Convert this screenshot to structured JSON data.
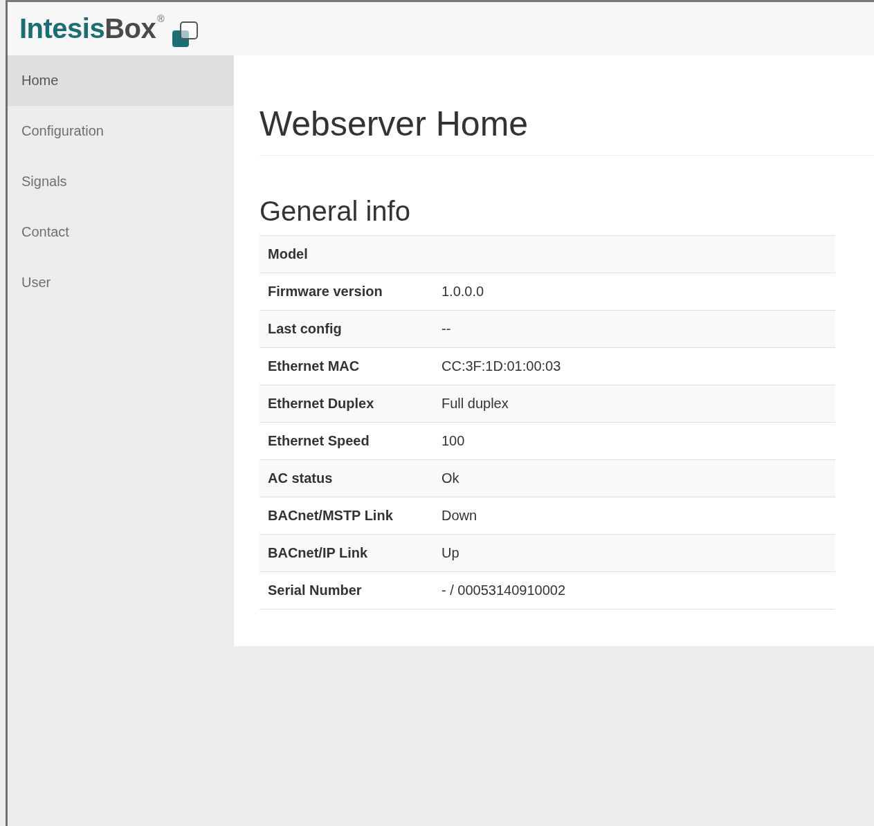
{
  "logo": {
    "parts": [
      "Intesis",
      "Box"
    ],
    "mark": "®"
  },
  "sidebar": {
    "items": [
      {
        "label": "Home",
        "selected": true
      },
      {
        "label": "Configuration",
        "selected": false
      },
      {
        "label": "Signals",
        "selected": false
      },
      {
        "label": "Contact",
        "selected": false
      },
      {
        "label": "User",
        "selected": false
      }
    ]
  },
  "page_title": "Webserver Home",
  "section_title": "General info",
  "table": {
    "rows": [
      {
        "label": "Model"
      },
      {
        "label": "Firmware version",
        "value": "1.0.0.0"
      },
      {
        "label": "Last config",
        "value": "--"
      },
      {
        "label": "Ethernet MAC",
        "value": "CC:3F:1D:01:00:03"
      },
      {
        "label": "Ethernet Duplex",
        "value": "Full duplex"
      },
      {
        "label": "Ethernet Speed",
        "value": "100"
      },
      {
        "label": "AC status",
        "value": "Ok"
      },
      {
        "label": "BACnet/MSTP Link",
        "value": "Down"
      },
      {
        "label": "BACnet/IP Link",
        "value": "Up"
      },
      {
        "label": "Serial Number",
        "value": "- / 00053140910002"
      }
    ]
  }
}
